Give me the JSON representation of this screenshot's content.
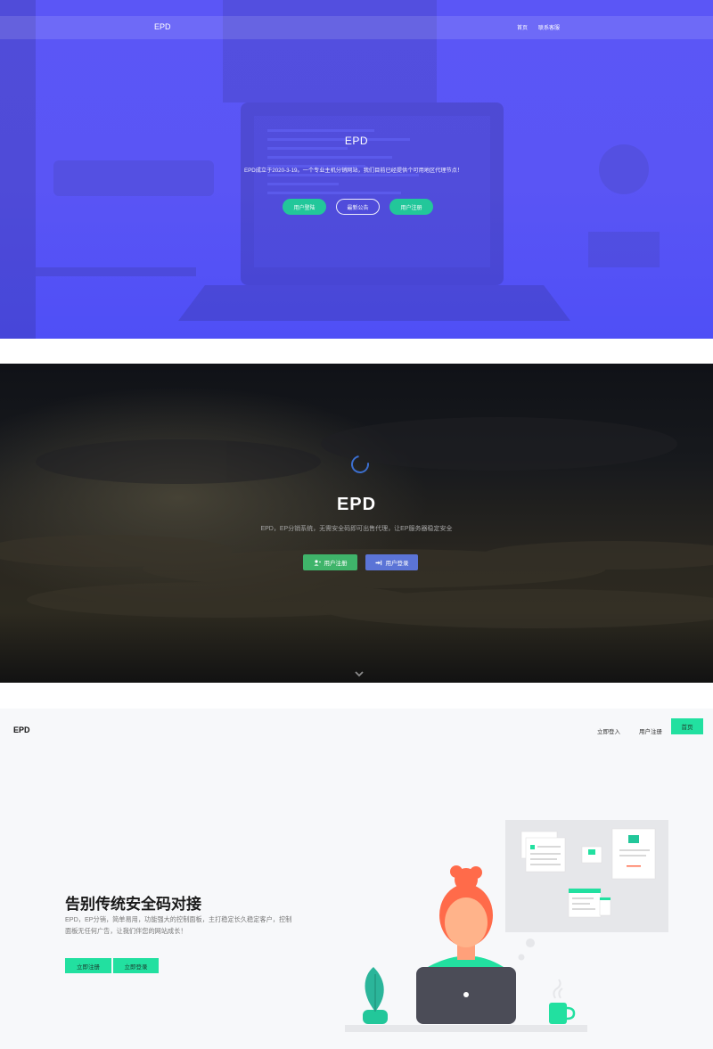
{
  "hero1": {
    "brand": "EPD",
    "nav": [
      "首页",
      "联系客服"
    ],
    "title": "EPD",
    "description": "EPD成立于2020-3-19。一个专业主机分销网站，我们目前已经提供个可用地区代理节点！",
    "buttons": [
      "用户登陆",
      "最新公告",
      "用户注册"
    ]
  },
  "hero2": {
    "title": "EPD",
    "description": "EPD，EP分销系统，无需安全码即可出售代理，让EP服务器稳定安全",
    "buttons": [
      "用户注册",
      "用户登录"
    ]
  },
  "landing": {
    "logo": "EPD",
    "nav": [
      "立即登入",
      "用户注册"
    ],
    "nav_button": "首页",
    "title": "告别传统安全码对接",
    "description": "EPD，EP分销，简单易用，功能强大的控制面板，主打稳定长久稳定客户，控制面板无任何广告，让我们伴您的网站成长！",
    "buttons": [
      "立即注册",
      "立即登录"
    ]
  },
  "colors": {
    "hero1_bg": "#5b56f6",
    "accent_green": "#22c79a",
    "landing_accent": "#22e0a0",
    "hero2_green": "#3fb46a",
    "hero2_blue": "#5b74d6"
  }
}
